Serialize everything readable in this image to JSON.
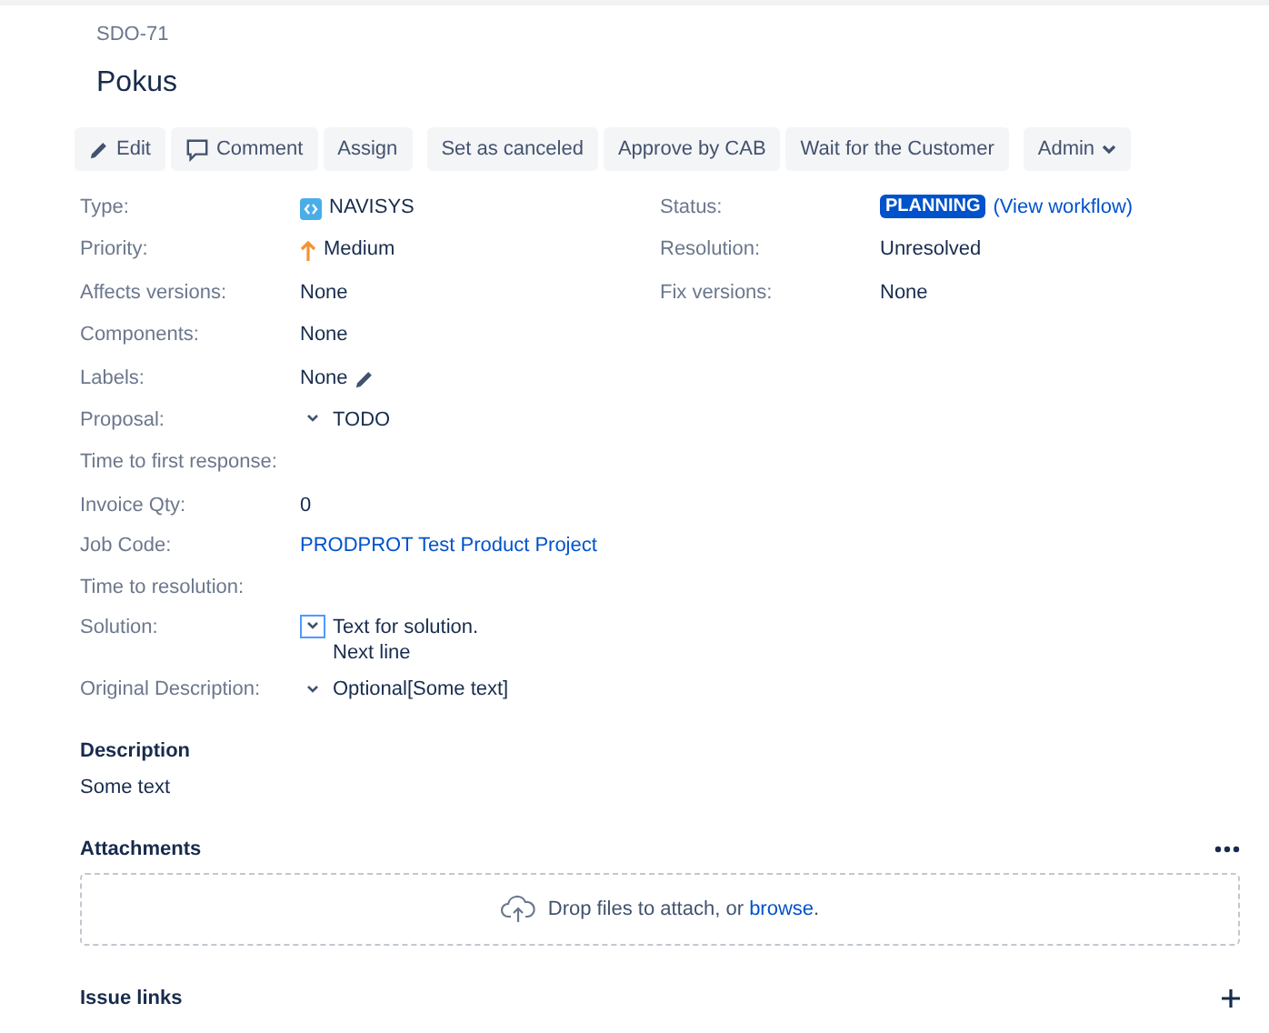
{
  "issue": {
    "key": "SDO-71",
    "summary": "Pokus"
  },
  "toolbar": [
    {
      "group": [
        {
          "label": "Edit",
          "kind": "pencil"
        },
        {
          "label": "Comment",
          "kind": "comment"
        },
        {
          "label": "Assign",
          "kind": "plain"
        }
      ]
    },
    {
      "group": [
        {
          "label": "Set as canceled"
        },
        {
          "label": "Approve by CAB"
        },
        {
          "label": "Wait for the Customer"
        }
      ]
    },
    {
      "group": [
        {
          "label": "Admin",
          "dropdown": true
        }
      ]
    }
  ],
  "details_left": [
    {
      "label": "Type:",
      "kind": "issue-type",
      "value": [
        "NAVISYS"
      ]
    },
    {
      "label": "Priority:",
      "kind": "priority",
      "value": [
        "Medium"
      ]
    },
    {
      "label": "Affects versions:",
      "kind": "text",
      "value": [
        "None"
      ]
    },
    {
      "label": "Components:",
      "kind": "text",
      "value": [
        "None"
      ]
    },
    {
      "label": "Labels:",
      "kind": "editable",
      "value": [
        "None"
      ]
    },
    {
      "label": "Proposal:",
      "kind": "collapsible",
      "focused": false,
      "value": [
        "TODO"
      ]
    },
    {
      "label": "Time to first response:",
      "kind": "text"
    },
    {
      "label": "Invoice Qty:",
      "kind": "text",
      "value": [
        "0"
      ]
    },
    {
      "label": "Job Code:",
      "kind": "link",
      "value": [
        "PRODPROT Test Product Project"
      ]
    },
    {
      "label": "Time to resolution:",
      "kind": "text"
    },
    {
      "label": "Solution:",
      "kind": "collapsible",
      "focused": true,
      "value": [
        "Text for solution.",
        "Next line"
      ]
    },
    {
      "label": "Original Description:",
      "kind": "collapsible",
      "focused": false,
      "value": [
        "Optional[Some text]"
      ]
    }
  ],
  "details_right": [
    {
      "label": "Status:",
      "kind": "status",
      "value": [
        "PLANNING"
      ],
      "link": "(View workflow)"
    },
    {
      "label": "Resolution:",
      "kind": "text",
      "value": [
        "Unresolved"
      ]
    },
    {
      "label": "Fix versions:",
      "kind": "text",
      "value": [
        "None"
      ]
    }
  ],
  "description": {
    "heading": "Description",
    "text": "Some text"
  },
  "attachments": {
    "heading": "Attachments",
    "drop_text": "Drop files to attach, or",
    "browse": "browse",
    "after": "."
  },
  "issue_links": {
    "heading": "Issue links"
  }
}
